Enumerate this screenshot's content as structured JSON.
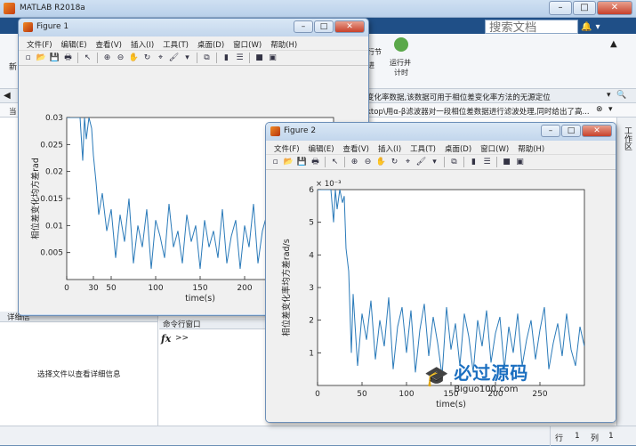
{
  "main": {
    "title": "MATLAB R2018a",
    "search_placeholder": "搜索文档",
    "ribbon_btn1": "行节",
    "ribbon_btn1b": "进",
    "ribbon_btn2": "运行并",
    "ribbon_btn2b": "计时",
    "ribbon_left": "新",
    "path_text": "变化率数据,该数据可用于相位差变化率方法的无源定位",
    "path_text2": "ktop\\用α-β滤波器对一段相位差数据进行滤波处理,同时给出了高...",
    "side_label": "工作区",
    "left_label": "当",
    "details_header": "详细信",
    "details_text": "选择文件以查看详细信息",
    "cmd_header": "命令行窗口",
    "fx": "fx",
    "prompt": ">>",
    "status_row": "行",
    "status_row_val": "1",
    "status_col": "列",
    "status_col_val": "1"
  },
  "menu": [
    "文件(F)",
    "编辑(E)",
    "查看(V)",
    "插入(I)",
    "工具(T)",
    "桌面(D)",
    "窗口(W)",
    "帮助(H)"
  ],
  "figures": [
    {
      "title": "Figure 1",
      "xlabel": "time(s)",
      "ylabel": "相位差变化均方差rad",
      "yticks": [
        "0.005",
        "0.01",
        "0.015",
        "0.02",
        "0.025",
        "0.03"
      ],
      "xticks": [
        "0",
        "50",
        "100",
        "150",
        "200",
        "250",
        "30"
      ]
    },
    {
      "title": "Figure 2",
      "xlabel": "time(s)",
      "ylabel": "相位差变化率均方差rad/s",
      "exponent": "× 10⁻³",
      "yticks": [
        "1",
        "2",
        "3",
        "4",
        "5",
        "6"
      ],
      "xticks": [
        "0",
        "50",
        "100",
        "150",
        "200",
        "250"
      ]
    }
  ],
  "watermark": {
    "text": "必过源码",
    "url": "Biguo100.com"
  },
  "colors": {
    "line": "#2a7ab9",
    "titlebar": "#c2d6ec"
  },
  "chart_data": [
    {
      "type": "line",
      "title": "",
      "xlabel": "time(s)",
      "ylabel": "相位差变化均方差rad",
      "xlim": [
        0,
        300
      ],
      "ylim": [
        0,
        0.03
      ],
      "series": [
        {
          "x": [
            0,
            5,
            10,
            15,
            18,
            20,
            22,
            25,
            28,
            30,
            33,
            36,
            40,
            45,
            50,
            55,
            60,
            65,
            70,
            75,
            80,
            85,
            90,
            95,
            100,
            105,
            110,
            115,
            120,
            125,
            130,
            135,
            140,
            145,
            150,
            155,
            160,
            165,
            170,
            175,
            180,
            185,
            190,
            195,
            200,
            205,
            210,
            215,
            220,
            225,
            230,
            235,
            240,
            245,
            250,
            255,
            260,
            265,
            270,
            275,
            280,
            285,
            290,
            295,
            300
          ],
          "y": [
            0.03,
            0.03,
            0.03,
            0.03,
            0.022,
            0.03,
            0.026,
            0.03,
            0.028,
            0.023,
            0.018,
            0.012,
            0.016,
            0.009,
            0.013,
            0.004,
            0.012,
            0.007,
            0.015,
            0.003,
            0.01,
            0.006,
            0.013,
            0.002,
            0.011,
            0.008,
            0.004,
            0.014,
            0.006,
            0.009,
            0.003,
            0.012,
            0.007,
            0.01,
            0.002,
            0.011,
            0.006,
            0.009,
            0.004,
            0.013,
            0.003,
            0.008,
            0.011,
            0.002,
            0.01,
            0.006,
            0.014,
            0.003,
            0.009,
            0.012,
            0.004,
            0.007,
            0.011,
            0.002,
            0.009,
            0.006,
            0.012,
            0.003,
            0.008,
            0.01,
            0.004,
            0.011,
            0.006,
            0.008,
            0.005
          ]
        }
      ]
    },
    {
      "type": "line",
      "title": "",
      "xlabel": "time(s)",
      "ylabel": "相位差变化率均方差rad/s",
      "xlim": [
        0,
        300
      ],
      "ylim": [
        0,
        6
      ],
      "y_exponent": "1e-3",
      "series": [
        {
          "x": [
            0,
            5,
            10,
            15,
            18,
            20,
            22,
            25,
            28,
            30,
            32,
            35,
            38,
            40,
            45,
            50,
            55,
            60,
            65,
            70,
            75,
            80,
            85,
            90,
            95,
            100,
            105,
            110,
            115,
            120,
            125,
            130,
            135,
            140,
            145,
            150,
            155,
            160,
            165,
            170,
            175,
            180,
            185,
            190,
            195,
            200,
            205,
            210,
            215,
            220,
            225,
            230,
            235,
            240,
            245,
            250,
            255,
            260,
            265,
            270,
            275,
            280,
            285,
            290,
            295,
            300
          ],
          "y": [
            6.0,
            6.0,
            6.0,
            6.0,
            5.0,
            6.0,
            5.4,
            6.0,
            5.6,
            5.8,
            4.2,
            3.5,
            1.0,
            2.8,
            0.6,
            2.2,
            1.4,
            2.6,
            0.8,
            2.0,
            1.2,
            2.7,
            0.5,
            1.8,
            2.4,
            1.0,
            2.3,
            0.4,
            1.7,
            2.5,
            0.9,
            2.1,
            1.3,
            0.3,
            2.4,
            1.1,
            1.9,
            0.6,
            2.2,
            1.5,
            0.4,
            2.0,
            1.2,
            2.3,
            0.7,
            1.6,
            2.1,
            0.5,
            1.8,
            1.0,
            2.2,
            0.6,
            1.4,
            2.0,
            0.8,
            1.7,
            2.4,
            0.5,
            1.3,
            1.9,
            0.9,
            2.2,
            1.1,
            0.6,
            1.8,
            1.2
          ]
        }
      ]
    }
  ]
}
